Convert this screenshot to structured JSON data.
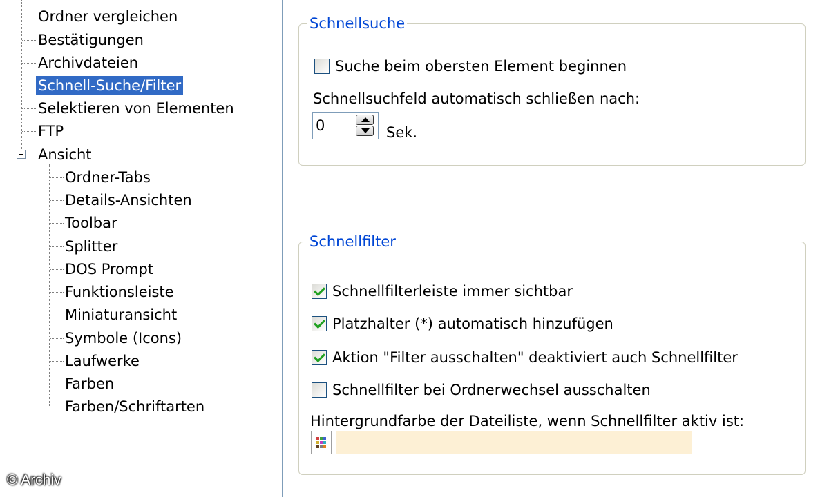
{
  "tree": {
    "items_top": [
      {
        "label": "Ordner vergleichen"
      },
      {
        "label": "Bestätigungen"
      },
      {
        "label": "Archivdateien"
      },
      {
        "label": "Schnell-Suche/Filter",
        "selected": true
      },
      {
        "label": "Selektieren von Elementen"
      },
      {
        "label": "FTP"
      }
    ],
    "ansicht": {
      "label": "Ansicht",
      "expanded": true,
      "children": [
        {
          "label": "Ordner-Tabs"
        },
        {
          "label": "Details-Ansichten"
        },
        {
          "label": "Toolbar"
        },
        {
          "label": "Splitter"
        },
        {
          "label": "DOS Prompt"
        },
        {
          "label": "Funktionsleiste"
        },
        {
          "label": "Miniaturansicht"
        },
        {
          "label": "Symbole (Icons)"
        },
        {
          "label": "Laufwerke"
        },
        {
          "label": "Farben"
        },
        {
          "label": "Farben/Schriftarten"
        }
      ]
    }
  },
  "watermark": "© Archiv",
  "schnellsuche": {
    "title": "Schnellsuche",
    "search_top_checkbox": {
      "label": "Suche beim obersten Element beginnen",
      "checked": false
    },
    "autoclose_label": "Schnellsuchfeld automatisch schließen nach:",
    "autoclose_value": "0",
    "autoclose_unit": "Sek."
  },
  "schnellfilter": {
    "title": "Schnellfilter",
    "options": [
      {
        "label": "Schnellfilterleiste immer sichtbar",
        "checked": true
      },
      {
        "label": "Platzhalter (*) automatisch hinzufügen",
        "checked": true
      },
      {
        "label": "Aktion \"Filter ausschalten\" deaktiviert auch Schnellfilter",
        "checked": true
      },
      {
        "label": "Schnellfilter bei Ordnerwechsel ausschalten",
        "checked": false
      }
    ],
    "bgcolor_label": "Hintergrundfarbe der Dateiliste, wenn Schnellfilter aktiv ist:",
    "bgcolor_value": "#fdf0d5"
  },
  "colors": {
    "selection": "#316ac5",
    "group_title": "#0046d5",
    "check_mark": "#21a121"
  }
}
